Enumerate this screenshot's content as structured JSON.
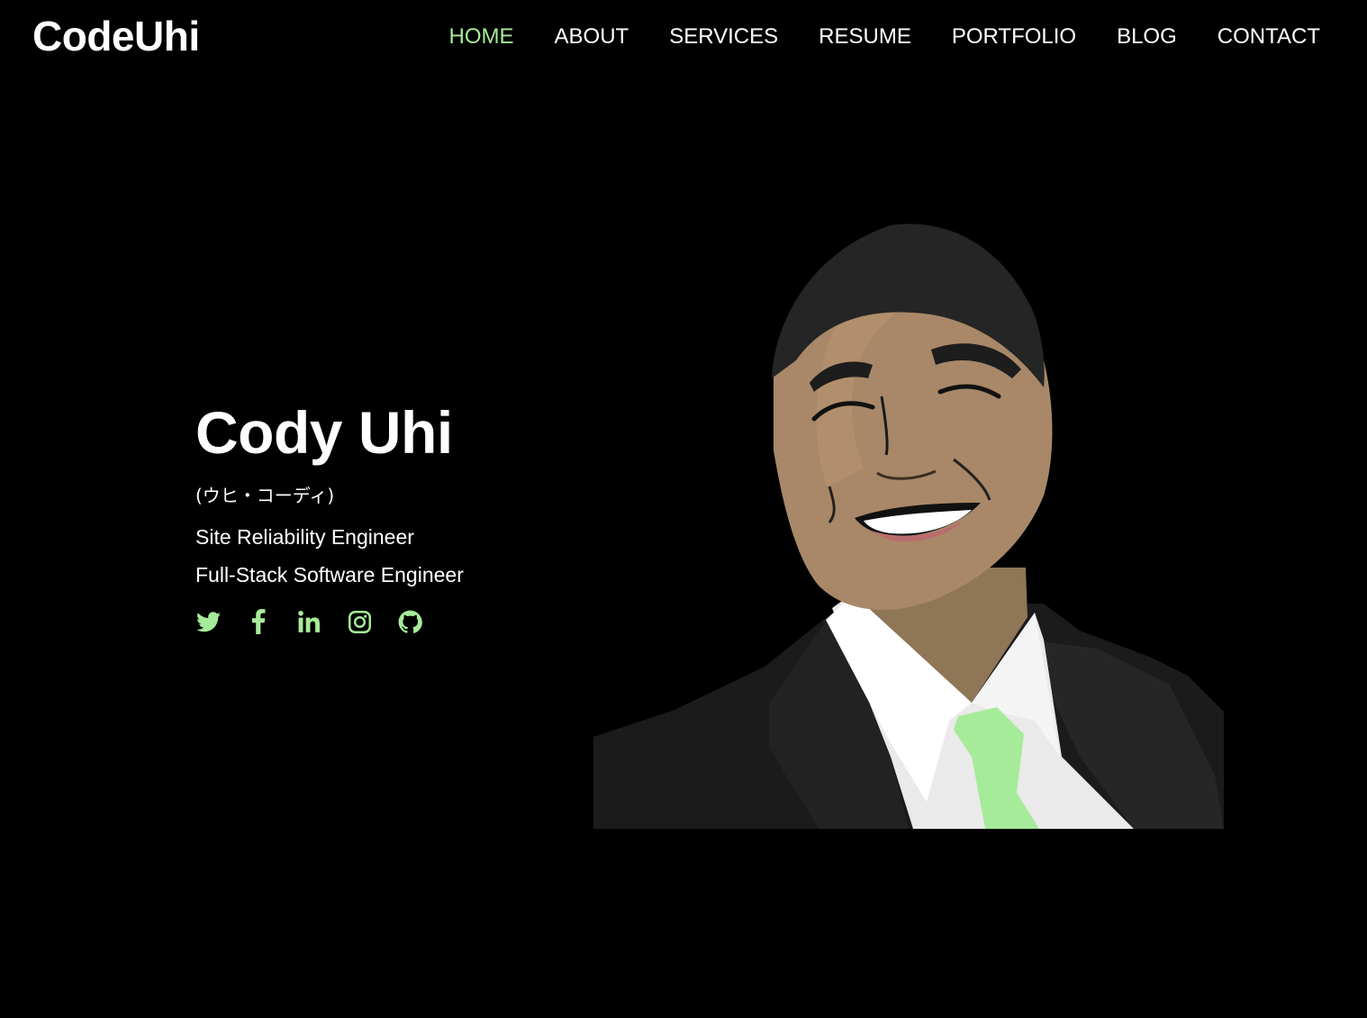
{
  "brand": {
    "logo_text": "CodeUhi",
    "accent_color": "#a6eb99"
  },
  "nav": {
    "items": [
      {
        "label": "HOME",
        "active": true
      },
      {
        "label": "ABOUT",
        "active": false
      },
      {
        "label": "SERVICES",
        "active": false
      },
      {
        "label": "RESUME",
        "active": false
      },
      {
        "label": "PORTFOLIO",
        "active": false
      },
      {
        "label": "BLOG",
        "active": false
      },
      {
        "label": "CONTACT",
        "active": false
      }
    ]
  },
  "hero": {
    "name": "Cody Uhi",
    "kana": "(ウヒ・コーディ)",
    "roles": [
      "Site Reliability Engineer",
      "Full-Stack Software Engineer"
    ],
    "social_icons": [
      "twitter-icon",
      "facebook-icon",
      "linkedin-icon",
      "instagram-icon",
      "github-icon"
    ]
  }
}
